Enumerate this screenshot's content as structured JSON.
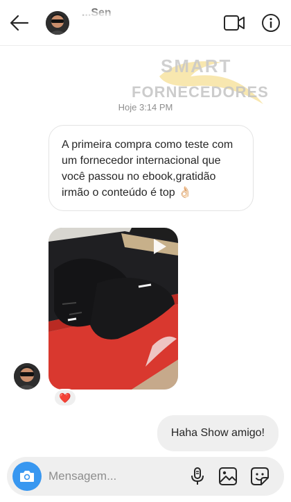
{
  "header": {
    "contact_name": "...Sen",
    "icons": {
      "back": "arrow-left-icon",
      "video_call": "video-camera-icon",
      "info": "info-icon"
    }
  },
  "watermark": {
    "line1": "SMART",
    "line2": "FORNECEDORES"
  },
  "thread": {
    "timestamp": "Hoje 3:14 PM",
    "incoming_message": "A primeira compra como teste com um fornecedor internacional que você passou no ebook,gratidão irmão o conteúdo é top 👌🏻",
    "video_message": {
      "play_icon": "play-icon",
      "content": "black sneakers in red box"
    },
    "reaction": "❤️",
    "outgoing_message": "Haha Show amigo!"
  },
  "composer": {
    "placeholder": "Mensagem...",
    "icons": {
      "camera": "camera-icon",
      "mic": "microphone-icon",
      "gallery": "image-icon",
      "sticker": "sticker-icon"
    }
  },
  "colors": {
    "accent": "#3897f0",
    "reaction_heart": "#ed4956",
    "outgoing_bubble": "#efefef"
  }
}
